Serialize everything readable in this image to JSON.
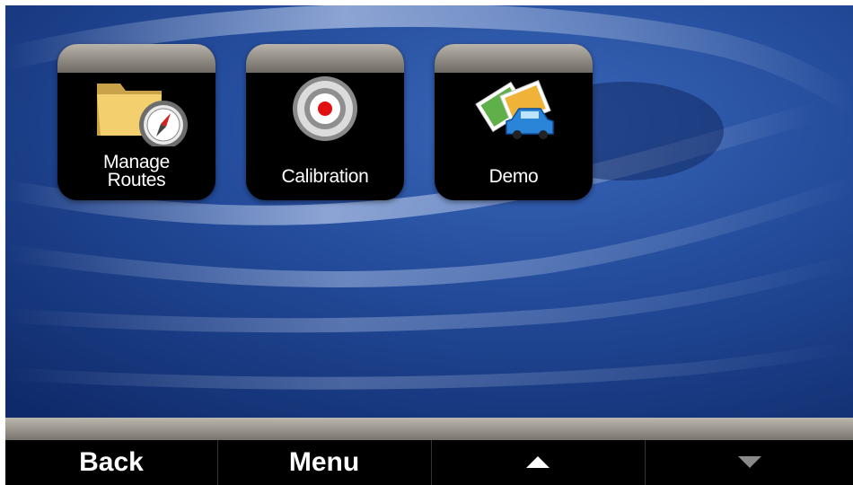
{
  "tiles": [
    {
      "label_line1": "Manage",
      "label_line2": "Routes",
      "icon": "folder-compass-icon"
    },
    {
      "label": "Calibration",
      "icon": "target-icon"
    },
    {
      "label": "Demo",
      "icon": "demo-car-photos-icon"
    }
  ],
  "bottom_bar": {
    "back_label": "Back",
    "menu_label": "Menu",
    "scroll_up_icon": "arrow-up-icon",
    "scroll_down_icon": "arrow-down-icon"
  },
  "colors": {
    "wallpaper": "#1d3f88",
    "tile_background": "#000000",
    "label_text": "#ffffff",
    "target_red": "#e01010"
  }
}
